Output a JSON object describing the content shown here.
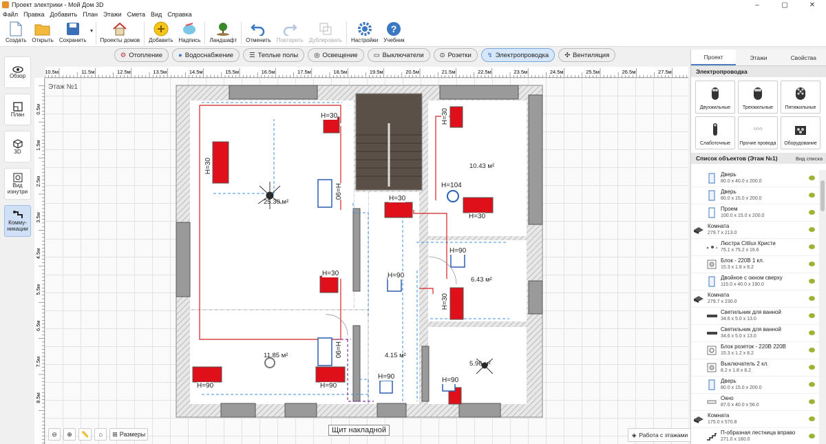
{
  "window": {
    "title": "Проект электрики - Мой Дом 3D",
    "controls": [
      "–",
      "▢",
      "✕"
    ]
  },
  "menu": [
    "Файл",
    "Правка",
    "Добавить",
    "План",
    "Этажи",
    "Смета",
    "Вид",
    "Справка"
  ],
  "toolbar": {
    "create": "Создать",
    "open": "Открыть",
    "save": "Сохранить",
    "projects": "Проекты домов",
    "add": "Добавить",
    "label": "Надпись",
    "landscape": "Ландшафт",
    "undo": "Отменить",
    "redo": "Повторить",
    "duplicate": "Дублировать",
    "settings": "Настройки",
    "tutorial": "Учебник"
  },
  "left_nav": {
    "overview": "Обзор",
    "plan": "План",
    "view3d": "3D",
    "inside_1": "Вид",
    "inside_2": "изнутри",
    "comm_1": "Комму-",
    "comm_2": "никации"
  },
  "filters": [
    "Отопление",
    "Водоснабжение",
    "Теплые полы",
    "Освещение",
    "Выключатели",
    "Розетки",
    "Электропроводка",
    "Вентиляция"
  ],
  "active_filter": "Электропроводка",
  "ruler_x": [
    "10.5м",
    "11.5м",
    "12.5м",
    "13.5м",
    "14.5м",
    "15.5м",
    "16.5м",
    "17.5м",
    "18.5м",
    "19.5м",
    "20.5м",
    "21.5м",
    "22.5м",
    "23.5м",
    "24.5м",
    "25.5м",
    "26.5м",
    "27.5м"
  ],
  "ruler_y": [
    "0.5м",
    "1.5м",
    "2.5м",
    "3.5м",
    "4.5м",
    "5.5м",
    "6.5м",
    "7.5м",
    "8.5м"
  ],
  "plan": {
    "floor_label": "Этаж №1",
    "rooms": {
      "big": "25.30 м²",
      "br": "10.43 м²",
      "mid": "6.43 м²",
      "bl": "11.85 м²",
      "bc": "4.15 м²",
      "brr": "5.96 м²"
    },
    "heights": {
      "h30": "H=30",
      "h90": "H=90",
      "h104": "H=104"
    },
    "panel_label": "Щит накладной"
  },
  "bottom": {
    "sizes": "Размеры",
    "floors_work": "Работа с этажами"
  },
  "right_panel": {
    "tabs": [
      "Проект",
      "Этажи",
      "Свойства"
    ],
    "section": "Электропроводка",
    "wires": [
      "Двухжильные",
      "Трехжильные",
      "Пятижильные",
      "Слаботочные",
      "Прочие провода",
      "Оборудование"
    ],
    "objects_title": "Список объектов (Этаж №1)",
    "view_list": "Вид списка",
    "objects": [
      {
        "name": "Дверь",
        "dims": "80.0 x 40.0 x 200.0",
        "child": true,
        "icon": "door-icon"
      },
      {
        "name": "Дверь",
        "dims": "80.0 x 15.0 x 200.0",
        "child": true,
        "icon": "door-icon"
      },
      {
        "name": "Проем",
        "dims": "100.0 x 15.0 x 200.0",
        "child": true,
        "icon": "opening-icon"
      },
      {
        "name": "Комната",
        "dims": "279.7 x 213.0",
        "child": false,
        "icon": "room-icon"
      },
      {
        "name": "Люстра Citilux Кристи",
        "dims": "75.1 x 75.2 x 16.6",
        "child": true,
        "icon": "chandelier-icon"
      },
      {
        "name": "Блок - 220В 1 кл.",
        "dims": "15.3 x 1.8 x 8.2",
        "child": true,
        "icon": "switch-icon"
      },
      {
        "name": "Двойное с окном сверху",
        "dims": "115.0 x 40.0 x 190.0",
        "child": true,
        "icon": "door-icon"
      },
      {
        "name": "Комната",
        "dims": "279.7 x 230.0",
        "child": false,
        "icon": "room-icon"
      },
      {
        "name": "Светильник для ванной",
        "dims": "34.6 x 5.0 x 13.0",
        "child": true,
        "icon": "lamp-icon"
      },
      {
        "name": "Светильник для ванной",
        "dims": "34.6 x 5.0 x 13.0",
        "child": true,
        "icon": "lamp-icon"
      },
      {
        "name": "Блок розеток - 220В 220В",
        "dims": "15.3 x 1.2 x 8.2",
        "child": true,
        "icon": "socket-icon"
      },
      {
        "name": "Выключатель 2 кл.",
        "dims": "8.2 x 1.8 x 8.2",
        "child": true,
        "icon": "switch-icon"
      },
      {
        "name": "Дверь",
        "dims": "80.0 x 15.0 x 200.0",
        "child": true,
        "icon": "door-icon"
      },
      {
        "name": "Окно",
        "dims": "87.0 x 40.0 x 56.0",
        "child": true,
        "icon": "window-icon"
      },
      {
        "name": "Комната",
        "dims": "175.0 x 570.8",
        "child": false,
        "icon": "room-icon"
      },
      {
        "name": "П-образная лестница вправо",
        "dims": "271.0 x 180.0",
        "child": true,
        "icon": "stairs-icon"
      }
    ]
  },
  "colors": {
    "accent": "#4a7cc0",
    "socket": "#e0101a",
    "wire_red": "#d42020",
    "wire_blue": "#3c8ee0"
  }
}
